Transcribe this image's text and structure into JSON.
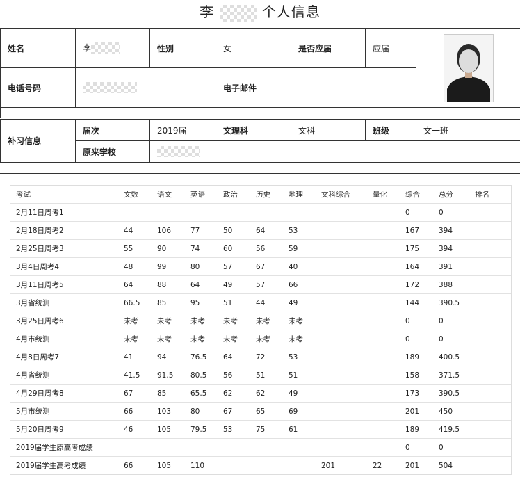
{
  "title": {
    "prefix": "李",
    "suffix": "个人信息"
  },
  "basic": {
    "name_label": "姓名",
    "name_value": "李",
    "gender_label": "性别",
    "gender_value": "女",
    "fresh_label": "是否应届",
    "fresh_value": "应届",
    "phone_label": "电话号码",
    "email_label": "电子邮件"
  },
  "tutoring": {
    "section_label": "补习信息",
    "session_label": "届次",
    "session_value": "2019届",
    "track_label": "文理科",
    "track_value": "文科",
    "class_label": "班级",
    "class_value": "文一班",
    "school_label": "原来学校"
  },
  "scores": {
    "headers": [
      "考试",
      "文数",
      "语文",
      "英语",
      "政治",
      "历史",
      "地理",
      "文科综合",
      "量化",
      "综合",
      "总分",
      "排名"
    ],
    "rows": [
      [
        "2月11日周考1",
        "",
        "",
        "",
        "",
        "",
        "",
        "",
        "",
        "0",
        "0",
        ""
      ],
      [
        "2月18日周考2",
        "44",
        "106",
        "77",
        "50",
        "64",
        "53",
        "",
        "",
        "167",
        "394",
        ""
      ],
      [
        "2月25日周考3",
        "55",
        "90",
        "74",
        "60",
        "56",
        "59",
        "",
        "",
        "175",
        "394",
        ""
      ],
      [
        "3月4日周考4",
        "48",
        "99",
        "80",
        "57",
        "67",
        "40",
        "",
        "",
        "164",
        "391",
        ""
      ],
      [
        "3月11日周考5",
        "64",
        "88",
        "64",
        "49",
        "57",
        "66",
        "",
        "",
        "172",
        "388",
        ""
      ],
      [
        "3月省统测",
        "66.5",
        "85",
        "95",
        "51",
        "44",
        "49",
        "",
        "",
        "144",
        "390.5",
        ""
      ],
      [
        "3月25日周考6",
        "未考",
        "未考",
        "未考",
        "未考",
        "未考",
        "未考",
        "",
        "",
        "0",
        "0",
        ""
      ],
      [
        "4月市统测",
        "未考",
        "未考",
        "未考",
        "未考",
        "未考",
        "未考",
        "",
        "",
        "0",
        "0",
        ""
      ],
      [
        "4月8日周考7",
        "41",
        "94",
        "76.5",
        "64",
        "72",
        "53",
        "",
        "",
        "189",
        "400.5",
        ""
      ],
      [
        "4月省统测",
        "41.5",
        "91.5",
        "80.5",
        "56",
        "51",
        "51",
        "",
        "",
        "158",
        "371.5",
        ""
      ],
      [
        "4月29日周考8",
        "67",
        "85",
        "65.5",
        "62",
        "62",
        "49",
        "",
        "",
        "173",
        "390.5",
        ""
      ],
      [
        "5月市统测",
        "66",
        "103",
        "80",
        "67",
        "65",
        "69",
        "",
        "",
        "201",
        "450",
        ""
      ],
      [
        "5月20日周考9",
        "46",
        "105",
        "79.5",
        "53",
        "75",
        "61",
        "",
        "",
        "189",
        "419.5",
        ""
      ],
      [
        "2019届学生原高考成绩",
        "",
        "",
        "",
        "",
        "",
        "",
        "",
        "",
        "0",
        "0",
        ""
      ],
      [
        "2019届学生高考成绩",
        "66",
        "105",
        "110",
        "",
        "",
        "",
        "201",
        "22",
        "201",
        "504",
        ""
      ]
    ]
  }
}
